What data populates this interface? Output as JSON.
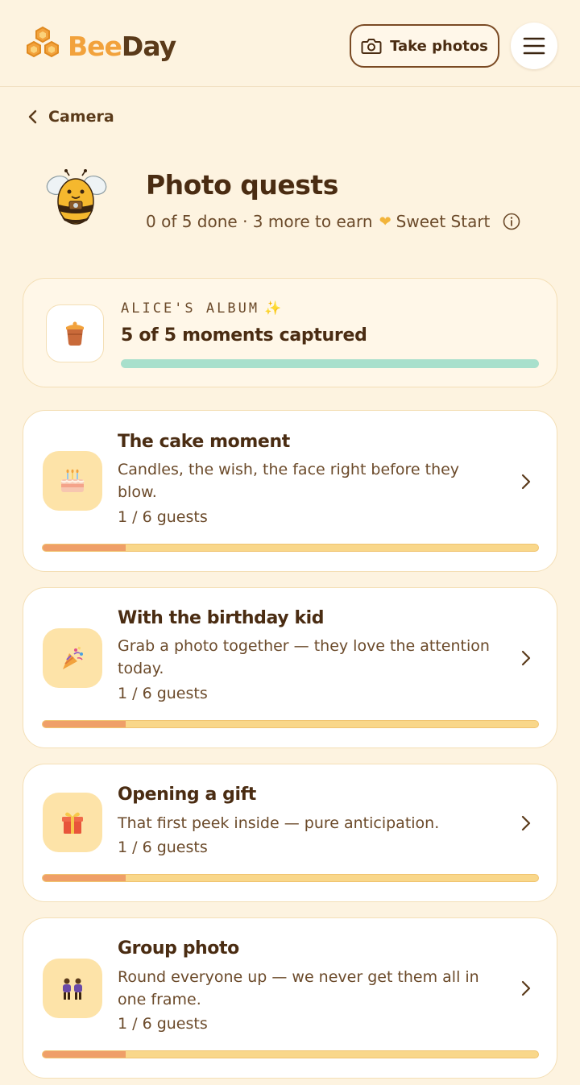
{
  "header": {
    "brand_bee": "Bee",
    "brand_day": "Day",
    "take_photos_label": "Take photos"
  },
  "nav": {
    "back_label": "Camera"
  },
  "page": {
    "title": "Photo quests",
    "subtitle_progress": "0 of 5 done · 3 more to earn",
    "subtitle_reward": "Sweet Start"
  },
  "album": {
    "label": "ALICE'S ALBUM",
    "captured_text": "5 of 5 moments captured",
    "progress_fraction": 1.0,
    "accent_color": "#a8e0cc"
  },
  "quests": [
    {
      "title": "The cake moment",
      "description": "Candles, the wish, the face right before they blow.",
      "progress_text": "1 / 6 guests",
      "progress_fraction": 0.1667,
      "icon": "cake-icon"
    },
    {
      "title": "With the birthday kid",
      "description": "Grab a photo together — they love the attention today.",
      "progress_text": "1 / 6 guests",
      "progress_fraction": 0.1667,
      "icon": "party-popper-icon"
    },
    {
      "title": "Opening a gift",
      "description": "That first peek inside — pure anticipation.",
      "progress_text": "1 / 6 guests",
      "progress_fraction": 0.1667,
      "icon": "gift-icon"
    },
    {
      "title": "Group photo",
      "description": "Round everyone up — we never get them all in one frame.",
      "progress_text": "1 / 6 guests",
      "progress_fraction": 0.1667,
      "icon": "people-icon"
    }
  ],
  "colors": {
    "background": "#fdf3e0",
    "brand_orange": "#f2a23c",
    "text_brown": "#4a2c12",
    "progress_fill": "#ef9f68",
    "progress_track": "#f9d78a"
  }
}
